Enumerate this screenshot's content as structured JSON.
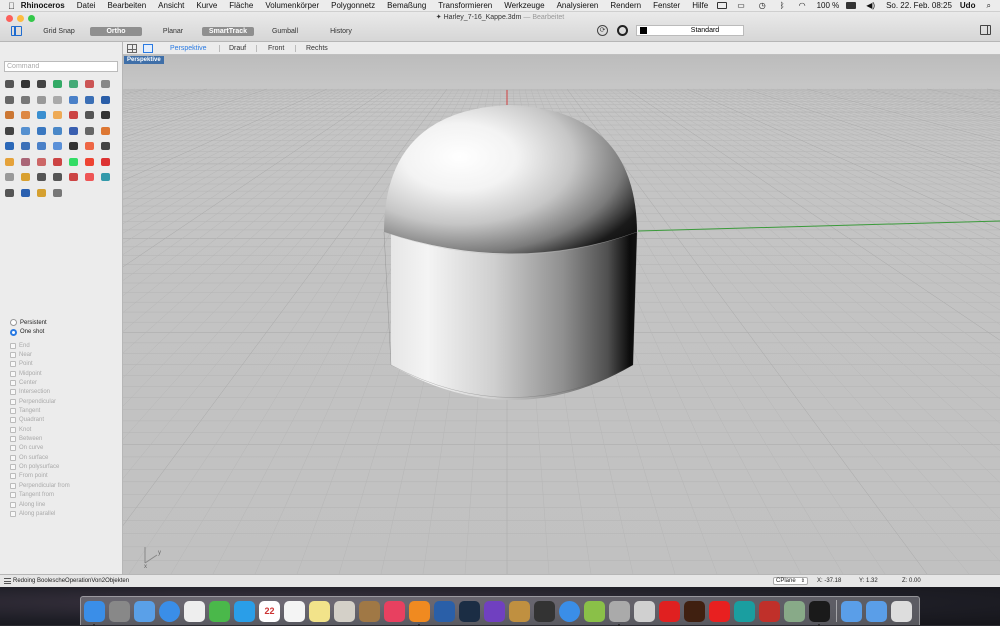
{
  "menubar": {
    "app_name": "Rhinoceros",
    "items": [
      "Datei",
      "Bearbeiten",
      "Ansicht",
      "Kurve",
      "Fläche",
      "Volumenkörper",
      "Polygonnetz",
      "Bemaßung",
      "Transformieren",
      "Werkzeuge",
      "Analysieren",
      "Rendern",
      "Fenster",
      "Hilfe"
    ],
    "battery": "100 %",
    "datetime": "So. 22. Feb.  08:25",
    "user": "Udo"
  },
  "window": {
    "filename": "Harley_7-16_Kappe.3dm",
    "separator": "—",
    "status": "Bearbeitet"
  },
  "toolbar": {
    "grid_snap": "Grid Snap",
    "ortho": "Ortho",
    "planar": "Planar",
    "smarttrack": "SmartTrack",
    "gumball": "Gumball",
    "history": "History",
    "layer": "Standard"
  },
  "command": {
    "placeholder": "Command"
  },
  "viewport_tabs": [
    "Perspektive",
    "Drauf",
    "Front",
    "Rechts"
  ],
  "viewport": {
    "label": "Perspektive",
    "axis_y": "y",
    "axis_x": "x"
  },
  "osnap": {
    "modes": [
      "Persistent",
      "One shot"
    ],
    "items": [
      "End",
      "Near",
      "Point",
      "Midpoint",
      "Center",
      "Intersection",
      "Perpendicular",
      "Tangent",
      "Quadrant",
      "Knot",
      "Between",
      "On curve",
      "On surface",
      "On polysurface",
      "From point",
      "Perpendicular from",
      "Tangent from",
      "Along line",
      "Along parallel"
    ]
  },
  "status": {
    "message": "Redoing BoolescheOperationVon2Objekten",
    "cplane": "CPlane",
    "x": "X: -37.18",
    "y": "Y: 1.32",
    "z": "Z: 0.00"
  },
  "day_number": "22",
  "tool_colors": [
    "#555",
    "#333",
    "#444",
    "#3a6",
    "#4a7",
    "#c55",
    "#888",
    "#666",
    "#777",
    "#999",
    "#aaa",
    "#4a80c8",
    "#3b6fb5",
    "#2a5ea8",
    "#c73",
    "#d84",
    "#3a8fd0",
    "#ea5",
    "#c44",
    "#555",
    "#333",
    "#444",
    "#5590d0",
    "#3a78c0",
    "#4a88c8",
    "#3a5fb0",
    "#666",
    "#d73",
    "#2b68b8",
    "#3c70b8",
    "#4a80c8",
    "#5a90d8",
    "#333",
    "#e64",
    "#444",
    "#e5a23a",
    "#a67",
    "#c66",
    "#c44",
    "#3d6",
    "#e43",
    "#d33",
    "#999",
    "#d9a030",
    "#555",
    "#555",
    "#c44",
    "#e55",
    "#39a",
    "#555",
    "#2a60b0",
    "#d5a030",
    "#777"
  ],
  "dock": [
    "#3a8ee8",
    "#888",
    "#5aa0e8",
    "#3a8ee8",
    "#eee",
    "#4ab84a",
    "#2a9ee8",
    "#ffffff",
    "#f4f4f4",
    "#f2e38a",
    "#d4d0c8",
    "#a07845",
    "#e84060",
    "#f08a20",
    "#2a5fa8",
    "#1b2d44",
    "#7040c0",
    "#c09040",
    "#333",
    "#3a8ee8",
    "#8ac048",
    "#aaa",
    "#d0d0d0",
    "#e02020",
    "#402010",
    "#e82020",
    "#1a9ea0",
    "#c0302a",
    "#88aa88",
    "#1a1a1a",
    "#5a9ee8",
    "#5a9ee8",
    "#ddd"
  ]
}
